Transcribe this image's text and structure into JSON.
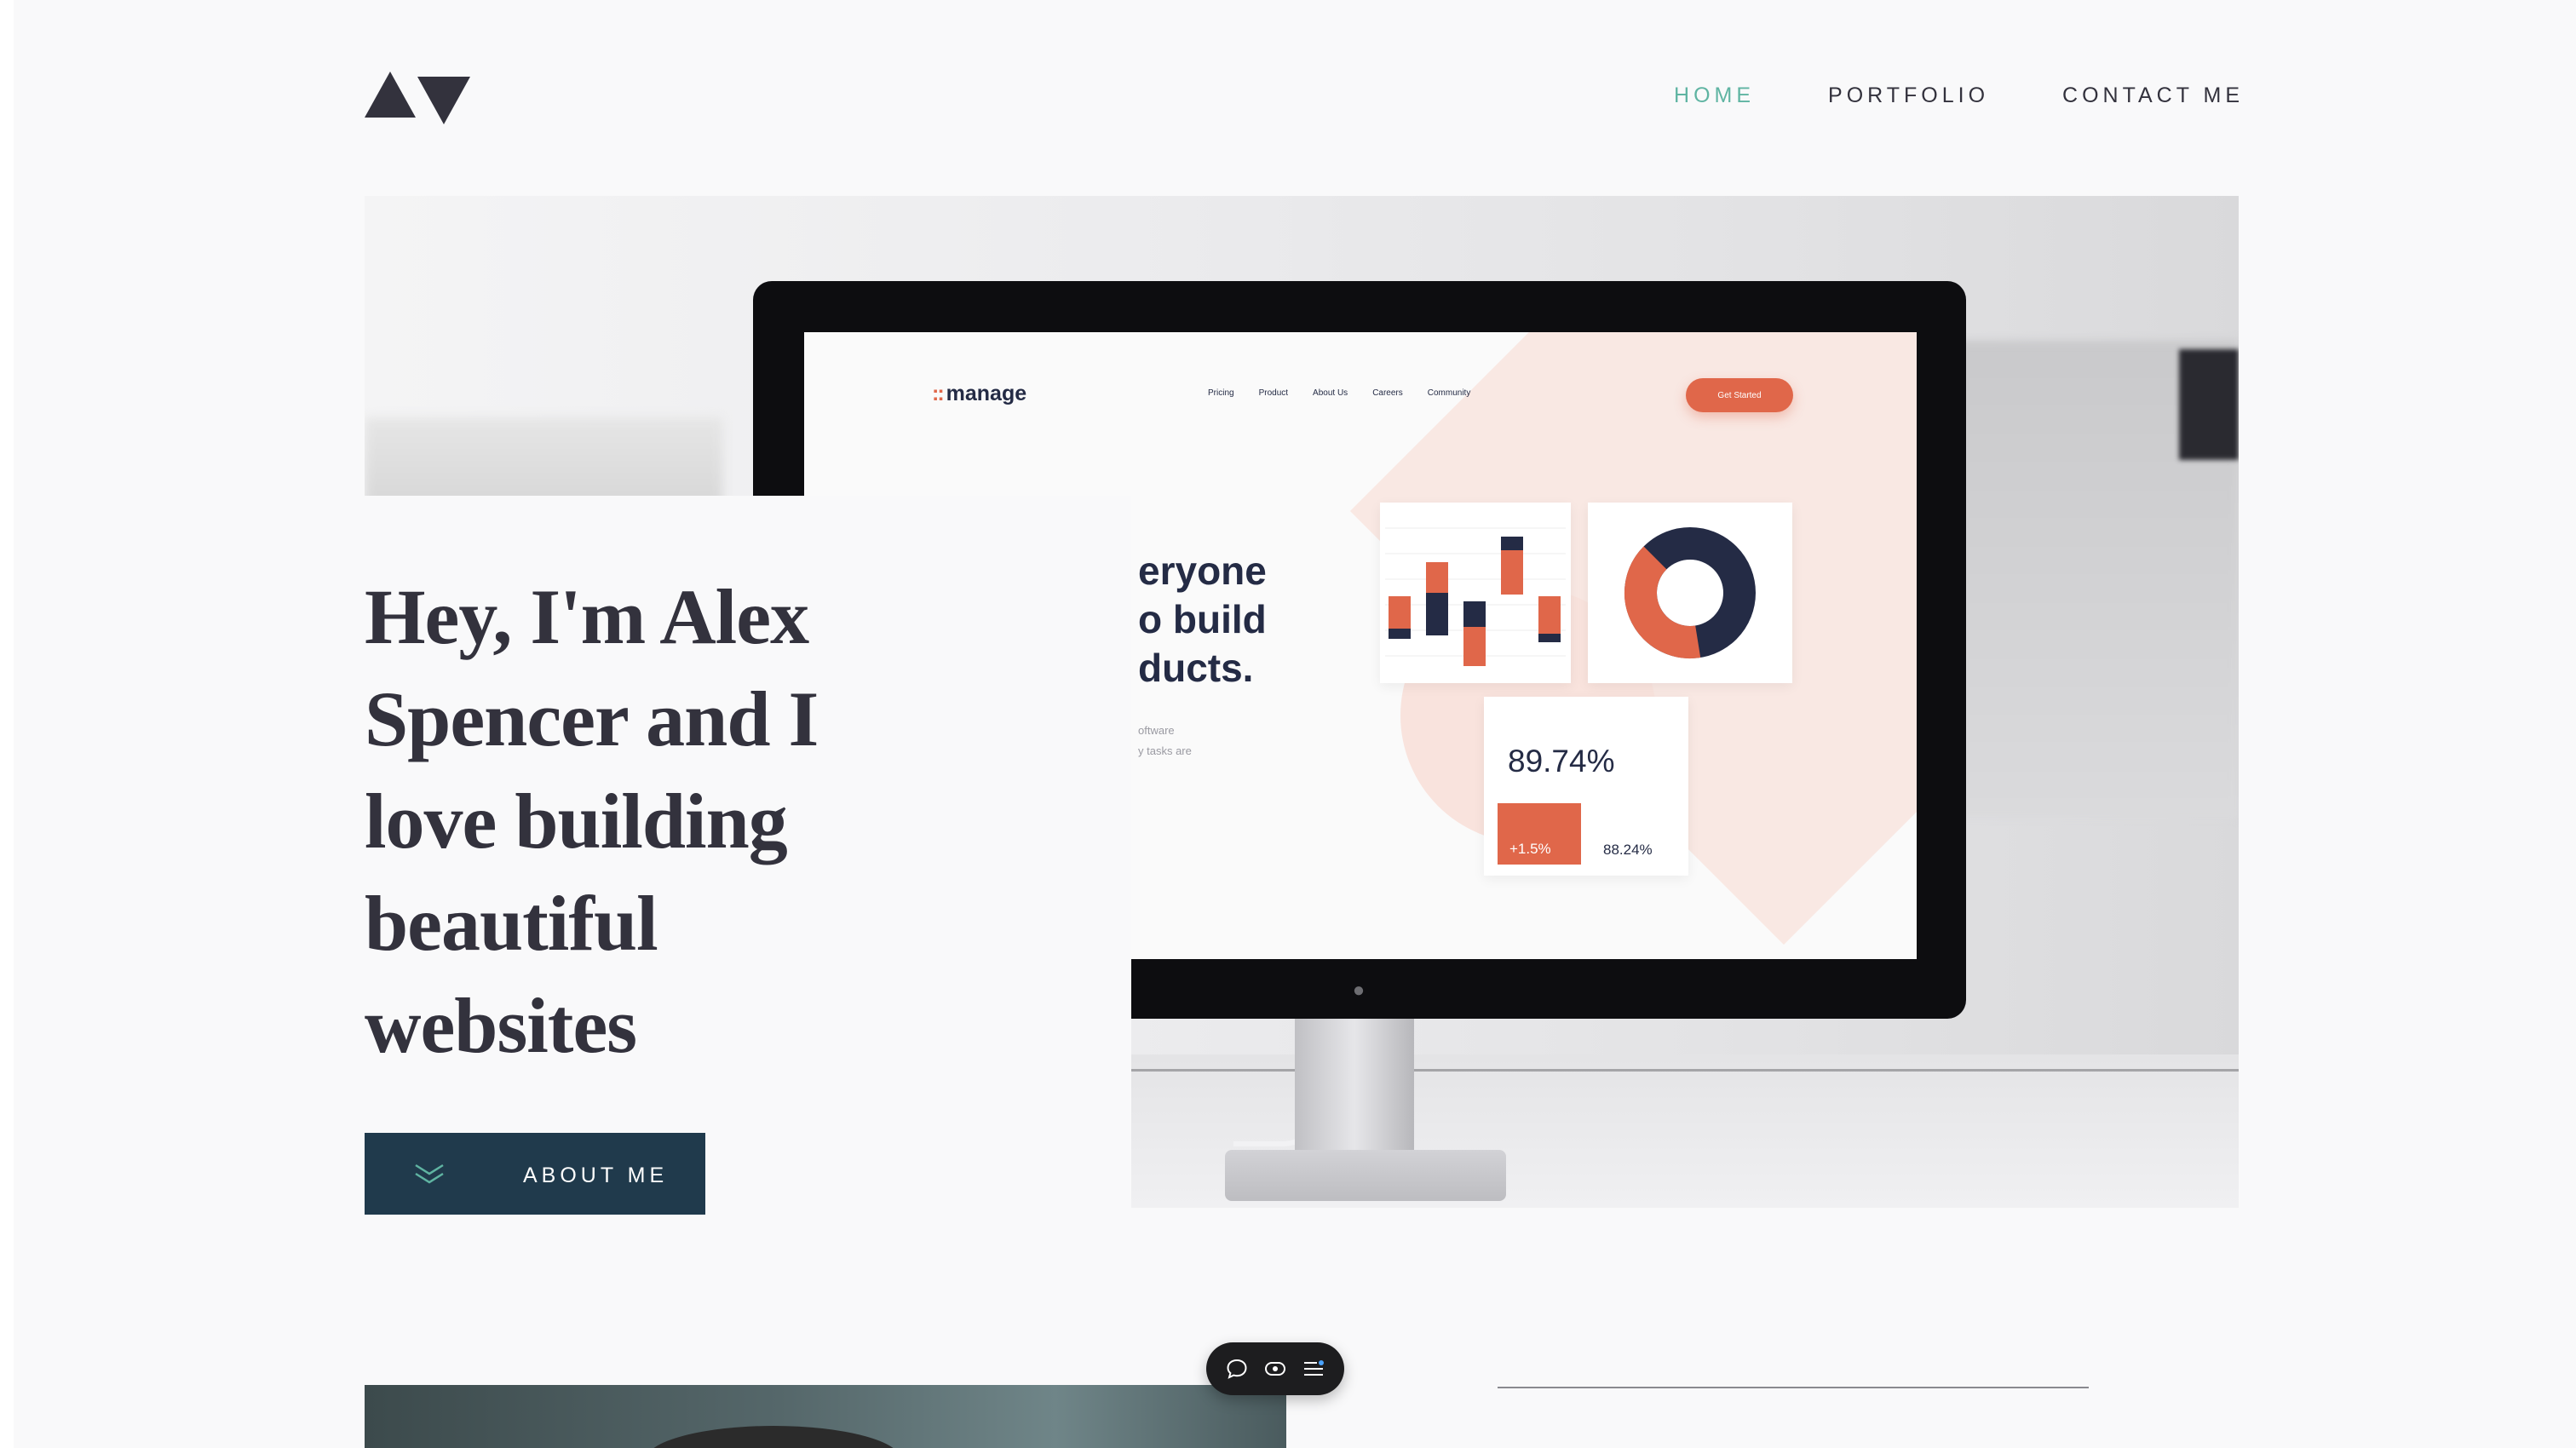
{
  "header": {
    "logo_name": "av-logo",
    "nav": [
      {
        "label": "HOME",
        "active": true
      },
      {
        "label": "PORTFOLIO",
        "active": false
      },
      {
        "label": "CONTACT ME",
        "active": false
      }
    ]
  },
  "hero": {
    "headline": "Hey, I'm Alex Spencer and I love building beautiful websites",
    "about_button_label": "ABOUT ME",
    "about_button_icon": "double-chevron-down-icon"
  },
  "monitor_screen": {
    "logo_text": "manage",
    "nav": [
      "Pricing",
      "Product",
      "About Us",
      "Careers",
      "Community"
    ],
    "cta_label": "Get Started",
    "headline_lines": [
      "eryone",
      "o build",
      "ducts."
    ],
    "sub_lines": [
      "oftware",
      "y tasks are"
    ],
    "stat_main": "89.74%",
    "stat_up": "+1.5%",
    "stat_secondary": "88.24%"
  },
  "toolbar": {
    "icons": [
      "comment-icon",
      "eye-icon",
      "list-settings-icon"
    ]
  },
  "colors": {
    "accent": "#5fb4a2",
    "dark_text": "#33323d",
    "button_bg": "#203a4c",
    "manage_orange": "#e0674a",
    "manage_navy": "#242b45"
  }
}
